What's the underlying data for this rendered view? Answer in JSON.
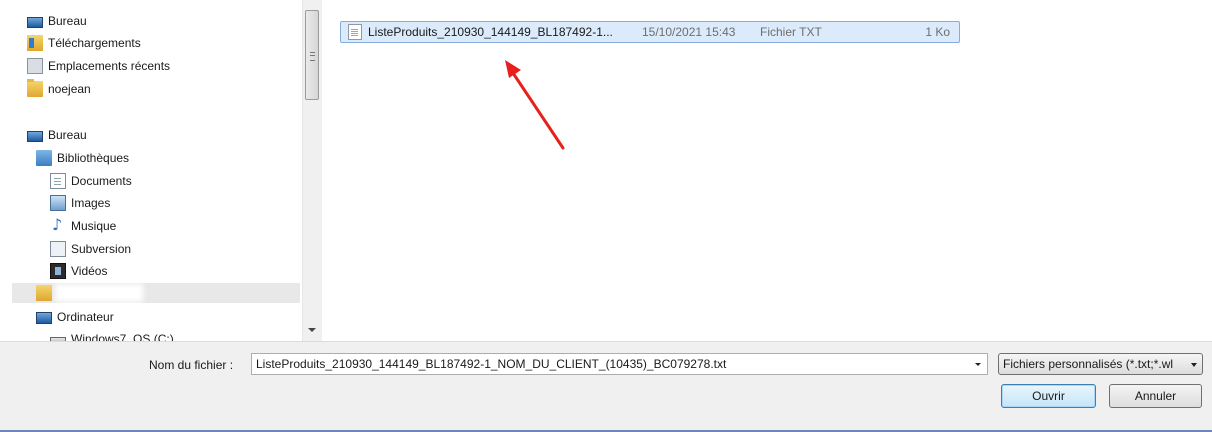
{
  "nav": {
    "items": [
      {
        "label": "Bureau",
        "icon": "desktop-icon"
      },
      {
        "label": "Téléchargements",
        "icon": "downloads-folder-icon"
      },
      {
        "label": "Emplacements récents",
        "icon": "recent-places-icon"
      },
      {
        "label": "noejean",
        "icon": "folder-icon"
      },
      {
        "label": "Bureau",
        "icon": "desktop-icon"
      },
      {
        "label": "Bibliothèques",
        "icon": "libraries-icon"
      },
      {
        "label": "Documents",
        "icon": "documents-icon"
      },
      {
        "label": "Images",
        "icon": "images-icon"
      },
      {
        "label": "Musique",
        "icon": "music-icon"
      },
      {
        "label": "Subversion",
        "icon": "subversion-icon"
      },
      {
        "label": "Vidéos",
        "icon": "videos-icon"
      },
      {
        "label": "",
        "icon": "user-folder-icon"
      },
      {
        "label": "Ordinateur",
        "icon": "computer-icon"
      },
      {
        "label": "Windows7_OS (C:)",
        "icon": "drive-icon"
      }
    ]
  },
  "file_list": {
    "rows": [
      {
        "name": "ListeProduits_210930_144149_BL187492-1...",
        "date": "15/10/2021 15:43",
        "type": "Fichier TXT",
        "size": "1 Ko",
        "icon": "text-file-icon"
      }
    ]
  },
  "bottom": {
    "filename_label": "Nom du fichier :",
    "filename_value": "ListeProduits_210930_144149_BL187492-1_NOM_DU_CLIENT_(10435)_BC079278.txt",
    "filter_value": "Fichiers personnalisés (*.txt;*.wl",
    "open_label": "Ouvrir",
    "cancel_label": "Annuler"
  },
  "colors": {
    "selection_bg": "#dcebfc",
    "selection_border": "#84acdd",
    "annotation_arrow": "#e8201c",
    "panel_bg": "#f0f0f0"
  }
}
